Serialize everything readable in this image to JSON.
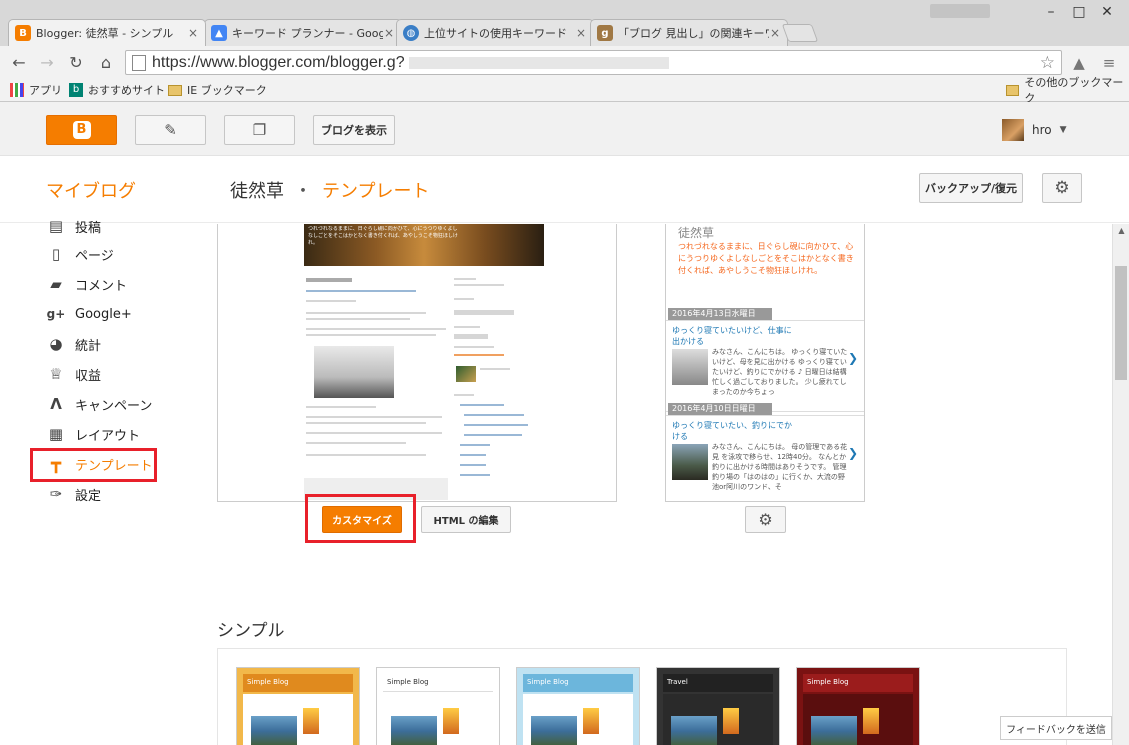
{
  "browser": {
    "tabs": [
      {
        "label": "Blogger: 徒然草 - シンプル",
        "favicon": "blogger-icon",
        "color": "#f57d00"
      },
      {
        "label": "キーワード プランナー - Google",
        "favicon": "adwords-icon",
        "color": "#4285f4"
      },
      {
        "label": "上位サイトの使用キーワード",
        "favicon": "globe-icon",
        "color": "#3a7ec6"
      },
      {
        "label": "「ブログ 見出し」の関連キーワー",
        "favicon": "g-icon",
        "color": "#a07844"
      }
    ],
    "url": "https://www.blogger.com/blogger.g?",
    "bookmarks": [
      {
        "label": "アプリ",
        "icon": "apps-grid-icon"
      },
      {
        "label": "おすすめサイト",
        "icon": "bing-icon"
      },
      {
        "label": "IE ブックマーク",
        "icon": "folder-icon"
      }
    ],
    "other_bookmarks": "その他のブックマーク"
  },
  "header": {
    "view_blog": "ブログを表示",
    "user": "hro"
  },
  "subheader": {
    "my_blog": "マイブログ",
    "blog_name": "徒然草",
    "separator": "・",
    "page": "テンプレート",
    "backup": "バックアップ/復元"
  },
  "sidebar": {
    "items": [
      {
        "label": "投稿",
        "icon": "posts-icon"
      },
      {
        "label": "ページ",
        "icon": "pages-icon"
      },
      {
        "label": "コメント",
        "icon": "comment-icon"
      },
      {
        "label": "Google+",
        "icon": "google-plus-icon"
      },
      {
        "label": "統計",
        "icon": "stats-icon"
      },
      {
        "label": "収益",
        "icon": "trophy-icon"
      },
      {
        "label": "キャンペーン",
        "icon": "adwords-icon"
      },
      {
        "label": "レイアウト",
        "icon": "layout-icon"
      },
      {
        "label": "テンプレート",
        "icon": "template-icon",
        "active": true
      },
      {
        "label": "設定",
        "icon": "wrench-icon"
      }
    ]
  },
  "live": {
    "customize": "カスタマイズ",
    "edit_html": "HTML の編集"
  },
  "mobile_preview": {
    "blog_title": "徒然草",
    "quote": "つれづれなるままに、日ぐらし硯に向かひて、心にうつりゆくよしなしごとをそこはかとなく書き付くれば、あやしうこそ物狂ほしけれ。",
    "posts": [
      {
        "date": "2016年4月13日水曜日",
        "title": "ゆっくり寝ていたいけど、仕事に出かける",
        "text": "みなさん、こんにちは。 ゆっくり寝ていたいけど、母を見に出かける ゆっくり寝ていたいけど、釣りにでかける ♪ 日曜日は結構忙しく過ごしておりました。 少し疲れてしまったのか今ちょっ"
      },
      {
        "date": "2016年4月10日日曜日",
        "title": "ゆっくり寝ていたい、釣りにでかける",
        "text": "みなさん、こんにちは。 母の管理である花見 を泳攻で移らせ、12時40分。 なんとか釣りに出かける時間はありそうです。 管理釣り場の「はのはの」に行くか、大流の野池or阿川のワンド、そ"
      }
    ]
  },
  "gallery": {
    "title": "シンプル",
    "themes": [
      {
        "label": "Simple Blog",
        "header": "#e08a1e",
        "bg": "#f2b84a"
      },
      {
        "label": "Simple Blog",
        "header": "#ffffff",
        "bg": "#ffffff"
      },
      {
        "label": "Simple Blog",
        "header": "#6cb6dc",
        "bg": "#bfe2f2"
      },
      {
        "label": "Travel",
        "header": "#222222",
        "bg": "#333333"
      },
      {
        "label": "Simple Blog",
        "header": "#9b1c1c",
        "bg": "#7a1212"
      }
    ]
  },
  "feedback": "フィードバックを送信"
}
